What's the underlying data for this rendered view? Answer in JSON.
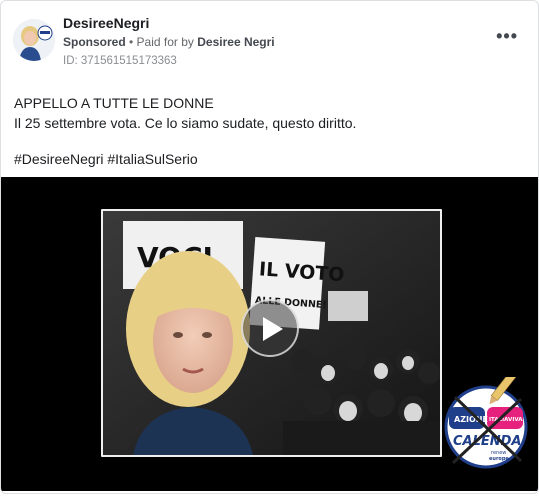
{
  "post": {
    "page_name": "DesireeNegri",
    "sponsored": "Sponsored",
    "separator": " • ",
    "paid_for_prefix": "Paid for by ",
    "paid_for_by": "Desiree Negri",
    "library_id": "ID: 371561515173363",
    "more_label": "•••",
    "text_line1": "APPELLO A TUTTE LE DONNE",
    "text_line2": "Il 25 settembre vota. Ce lo siamo sudate, questo diritto.",
    "hashtags": "#DesireeNegri #ItaliaSulSerio"
  },
  "video": {
    "sign_left": "VOCI",
    "sign_right_line1": "IL VOTO",
    "sign_right_line2": "ALLE DONNE!",
    "play_icon": "play-icon"
  },
  "logo": {
    "azione": "AZIONE",
    "italia_viva": "ITALIAVIVA",
    "calenda": "CALENDA",
    "renew_line1": "renew",
    "renew_line2": "europe."
  },
  "colors": {
    "accent_blue": "#1f3f8a",
    "logo_red": "#e3262d",
    "logo_pink": "#e5217d",
    "text_muted": "#65676b"
  }
}
